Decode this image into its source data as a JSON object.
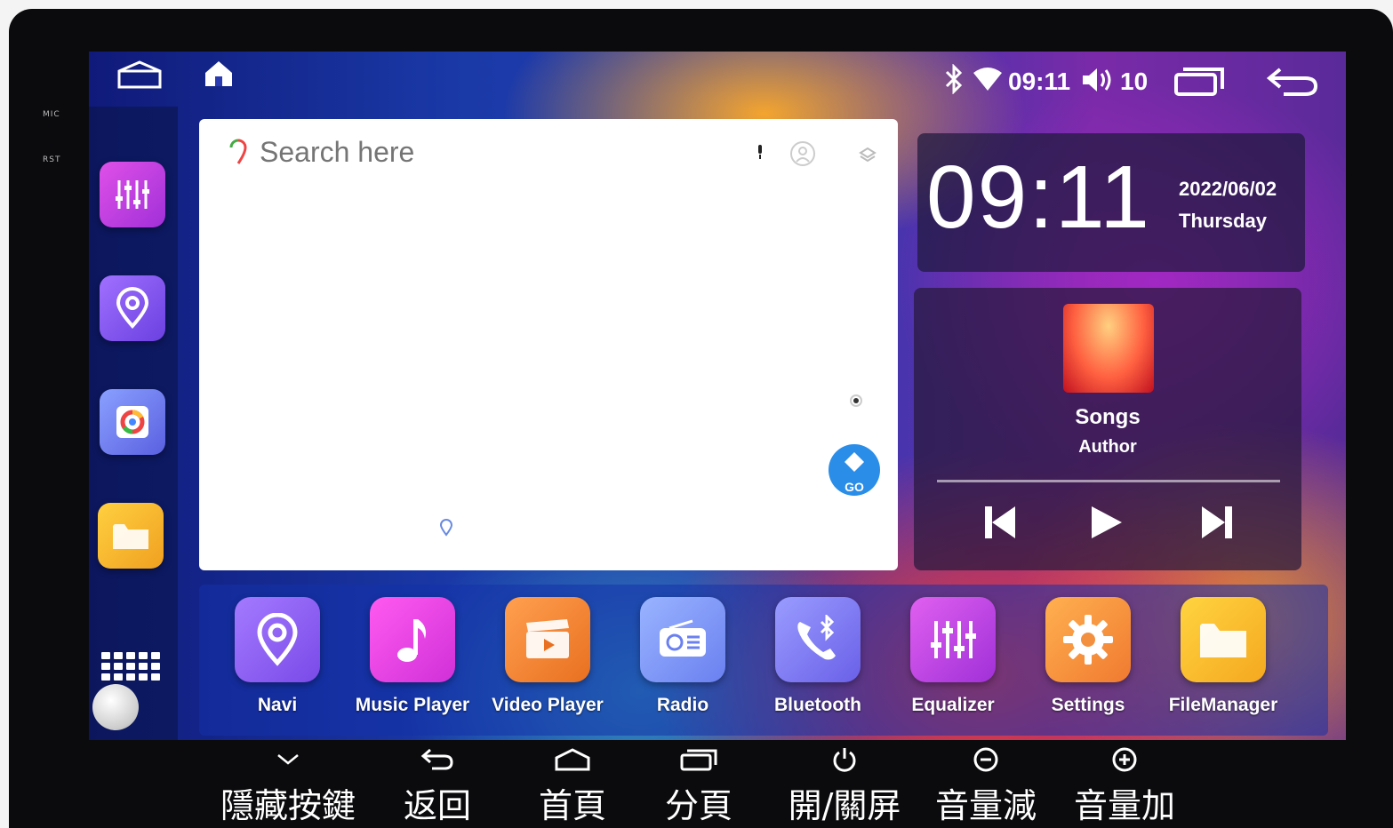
{
  "hardware": {
    "mic_label": "MIC",
    "rst_label": "RST"
  },
  "statusbar": {
    "time": "09:11",
    "volume": "10"
  },
  "map": {
    "search_placeholder": "Search here",
    "go_label": "GO"
  },
  "clock": {
    "time": "09:11",
    "date": "2022/06/02",
    "weekday": "Thursday"
  },
  "music": {
    "title": "Songs",
    "author": "Author"
  },
  "apps": [
    {
      "label": "Navi",
      "color": "#8a5cf0",
      "icon": "location-pin-icon"
    },
    {
      "label": "Music Player",
      "color": "#e83ce0",
      "icon": "music-note-icon"
    },
    {
      "label": "Video Player",
      "color": "#f08a30",
      "icon": "clapperboard-icon"
    },
    {
      "label": "Radio",
      "color": "#8aa0ff",
      "icon": "radio-icon"
    },
    {
      "label": "Bluetooth",
      "color": "#7a7cf0",
      "icon": "bluetooth-phone-icon"
    },
    {
      "label": "Equalizer",
      "color": "#c83ce8",
      "icon": "equalizer-icon"
    },
    {
      "label": "Settings",
      "color": "#f09a3a",
      "icon": "gear-icon"
    },
    {
      "label": "FileManager",
      "color": "#f5b830",
      "icon": "folder-icon"
    }
  ],
  "captions": [
    {
      "label": "隱藏按鍵",
      "icon": "chevron-down-icon"
    },
    {
      "label": "返回",
      "icon": "back-icon"
    },
    {
      "label": "首頁",
      "icon": "home-icon"
    },
    {
      "label": "分頁",
      "icon": "recent-apps-icon"
    },
    {
      "label": "開/關屏",
      "icon": "power-icon"
    },
    {
      "label": "音量減",
      "icon": "volume-minus-icon"
    },
    {
      "label": "音量加",
      "icon": "volume-plus-icon"
    }
  ]
}
